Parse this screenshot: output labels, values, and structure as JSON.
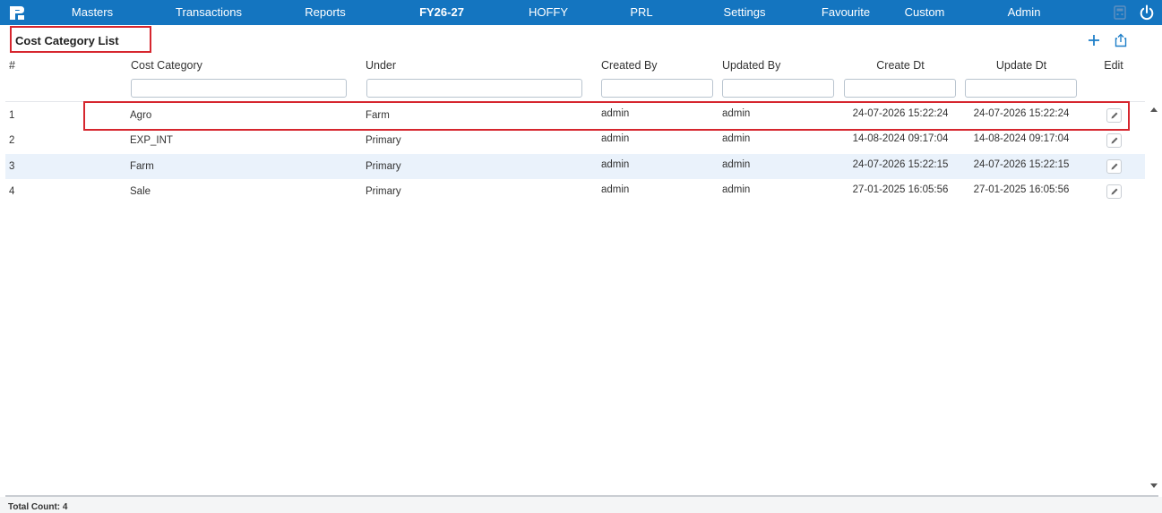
{
  "nav": {
    "items": [
      {
        "label": "Masters"
      },
      {
        "label": "Transactions"
      },
      {
        "label": "Reports"
      },
      {
        "label": "FY26-27"
      },
      {
        "label": "HOFFY"
      },
      {
        "label": "PRL"
      },
      {
        "label": "Settings"
      },
      {
        "label": "Favourite"
      },
      {
        "label": "Custom"
      },
      {
        "label": "Admin"
      }
    ],
    "icons": [
      "app-logo-icon",
      "calculator-icon",
      "power-icon"
    ],
    "bar_color": "#1475c0"
  },
  "page": {
    "title": "Cost Category List",
    "actions": [
      "plus-icon",
      "export-icon"
    ],
    "highlight_color": "#d6262e"
  },
  "table": {
    "columns": [
      "#",
      "Cost Category",
      "Under",
      "Created By",
      "Updated By",
      "Create Dt",
      "Update Dt",
      "Edit"
    ],
    "filters": [
      {
        "value": "",
        "placeholder": ""
      },
      {
        "value": "",
        "placeholder": ""
      },
      {
        "value": "",
        "placeholder": ""
      },
      {
        "value": "",
        "placeholder": ""
      },
      {
        "value": "",
        "placeholder": ""
      },
      {
        "value": "",
        "placeholder": ""
      }
    ],
    "rows": [
      {
        "num": "1",
        "category": "Agro",
        "under": "Farm",
        "created_by": "admin",
        "updated_by": "admin",
        "create_dt": "24-07-2026 15:22:24",
        "update_dt": "24-07-2026 15:22:24"
      },
      {
        "num": "2",
        "category": "EXP_INT",
        "under": "Primary",
        "created_by": "admin",
        "updated_by": "admin",
        "create_dt": "14-08-2024 09:17:04",
        "update_dt": "14-08-2024 09:17:04"
      },
      {
        "num": "3",
        "category": "Farm",
        "under": "Primary",
        "created_by": "admin",
        "updated_by": "admin",
        "create_dt": "24-07-2026 15:22:15",
        "update_dt": "24-07-2026 15:22:15"
      },
      {
        "num": "4",
        "category": "Sale",
        "under": "Primary",
        "created_by": "admin",
        "updated_by": "admin",
        "create_dt": "27-01-2025 16:05:56",
        "update_dt": "27-01-2025 16:05:56"
      }
    ],
    "alt_row_color": "#eaf2fb"
  },
  "footer": {
    "total_label": "Total Count: 4"
  }
}
